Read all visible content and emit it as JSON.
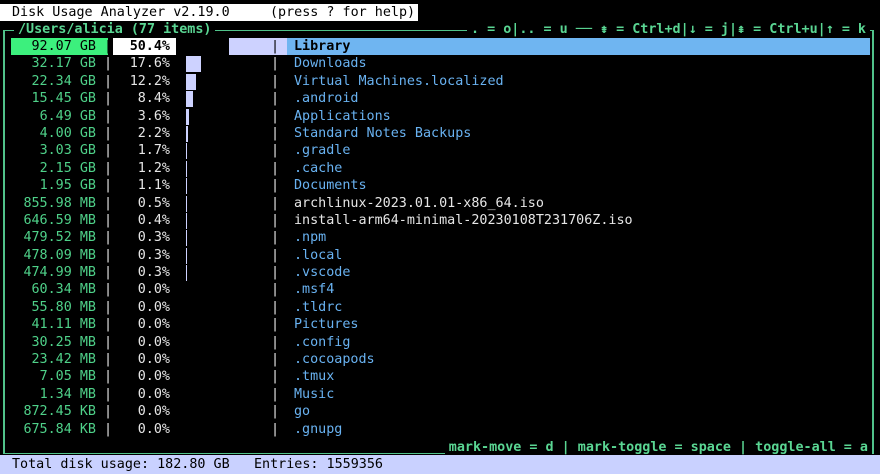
{
  "app": {
    "title": "Disk Usage Analyzer v2.19.0",
    "help_hint": "(press ? for help)"
  },
  "header": {
    "path_label": "/Users/alicia (77 items)",
    "keys": ". = o|.. = u ── ⇟ = Ctrl+d|↓ = j|⇞ = Ctrl+u|↑ = k"
  },
  "footer_keys": "mark-move = d | mark-toggle = space | toggle-all = a",
  "entries": [
    {
      "size": "92.07 GB",
      "pct": "50.4%",
      "share": 0.504,
      "name": "Library",
      "dir": true,
      "selected": true
    },
    {
      "size": "32.17 GB",
      "pct": "17.6%",
      "share": 0.176,
      "name": "Downloads",
      "dir": true
    },
    {
      "size": "22.34 GB",
      "pct": "12.2%",
      "share": 0.122,
      "name": "Virtual Machines.localized",
      "dir": true
    },
    {
      "size": "15.45 GB",
      "pct": "8.4%",
      "share": 0.084,
      "name": ".android",
      "dir": true
    },
    {
      "size": "6.49 GB",
      "pct": "3.6%",
      "share": 0.036,
      "name": "Applications",
      "dir": true
    },
    {
      "size": "4.00 GB",
      "pct": "2.2%",
      "share": 0.022,
      "name": "Standard Notes Backups",
      "dir": true
    },
    {
      "size": "3.03 GB",
      "pct": "1.7%",
      "share": 0.017,
      "name": ".gradle",
      "dir": true
    },
    {
      "size": "2.15 GB",
      "pct": "1.2%",
      "share": 0.012,
      "name": ".cache",
      "dir": true
    },
    {
      "size": "1.95 GB",
      "pct": "1.1%",
      "share": 0.011,
      "name": "Documents",
      "dir": true
    },
    {
      "size": "855.98 MB",
      "pct": "0.5%",
      "share": 0.005,
      "name": "archlinux-2023.01.01-x86_64.iso",
      "dir": false
    },
    {
      "size": "646.59 MB",
      "pct": "0.4%",
      "share": 0.004,
      "name": "install-arm64-minimal-20230108T231706Z.iso",
      "dir": false
    },
    {
      "size": "479.52 MB",
      "pct": "0.3%",
      "share": 0.003,
      "name": ".npm",
      "dir": true
    },
    {
      "size": "478.09 MB",
      "pct": "0.3%",
      "share": 0.003,
      "name": ".local",
      "dir": true
    },
    {
      "size": "474.99 MB",
      "pct": "0.3%",
      "share": 0.003,
      "name": ".vscode",
      "dir": true
    },
    {
      "size": "60.34 MB",
      "pct": "0.0%",
      "share": 0,
      "name": ".msf4",
      "dir": true
    },
    {
      "size": "55.80 MB",
      "pct": "0.0%",
      "share": 0,
      "name": ".tldrc",
      "dir": true
    },
    {
      "size": "41.11 MB",
      "pct": "0.0%",
      "share": 0,
      "name": "Pictures",
      "dir": true
    },
    {
      "size": "30.25 MB",
      "pct": "0.0%",
      "share": 0,
      "name": ".config",
      "dir": true
    },
    {
      "size": "23.42 MB",
      "pct": "0.0%",
      "share": 0,
      "name": ".cocoapods",
      "dir": true
    },
    {
      "size": "7.05 MB",
      "pct": "0.0%",
      "share": 0,
      "name": ".tmux",
      "dir": true
    },
    {
      "size": "1.34 MB",
      "pct": "0.0%",
      "share": 0,
      "name": "Music",
      "dir": true
    },
    {
      "size": "872.45 KB",
      "pct": "0.0%",
      "share": 0,
      "name": "go",
      "dir": true
    },
    {
      "size": "675.84 KB",
      "pct": "0.0%",
      "share": 0,
      "name": ".gnupg",
      "dir": true
    }
  ],
  "status": {
    "total": "Total disk usage: 182.80 GB",
    "entries": "Entries: 1559356"
  },
  "colors": {
    "accent_green": "#5ad693",
    "dir_blue": "#69b2f1",
    "bar": "#cdd2ff",
    "status_bg": "#c9d1ff"
  }
}
